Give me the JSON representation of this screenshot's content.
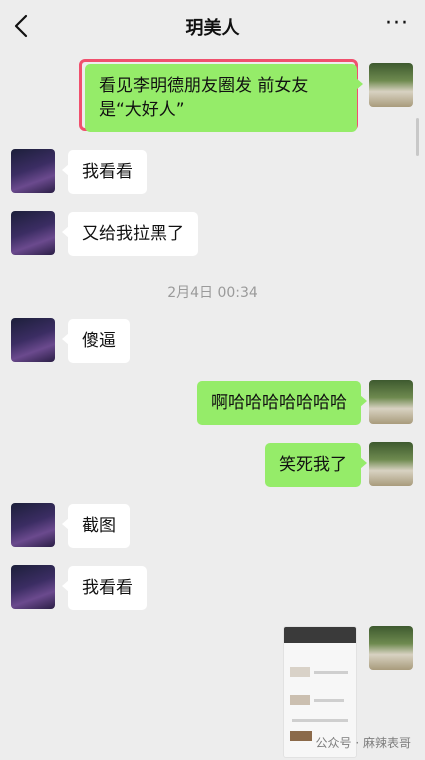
{
  "header": {
    "title": "玥美人",
    "more_label": "···"
  },
  "messages": {
    "m1": "看见李明德朋友圈发 前女友是“大好人”",
    "m2": "我看看",
    "m3": "又给我拉黑了",
    "time": "2月4日 00:34",
    "m4": "傻逼",
    "m5": "啊哈哈哈哈哈哈哈",
    "m6": "笑死我了",
    "m7": "截图",
    "m8": "我看看"
  },
  "watermark": "公众号 · 麻辣表哥",
  "colors": {
    "background": "#ededed",
    "bubble_outgoing": "#95ec69",
    "bubble_incoming": "#ffffff",
    "highlight_border": "#f0506e"
  }
}
